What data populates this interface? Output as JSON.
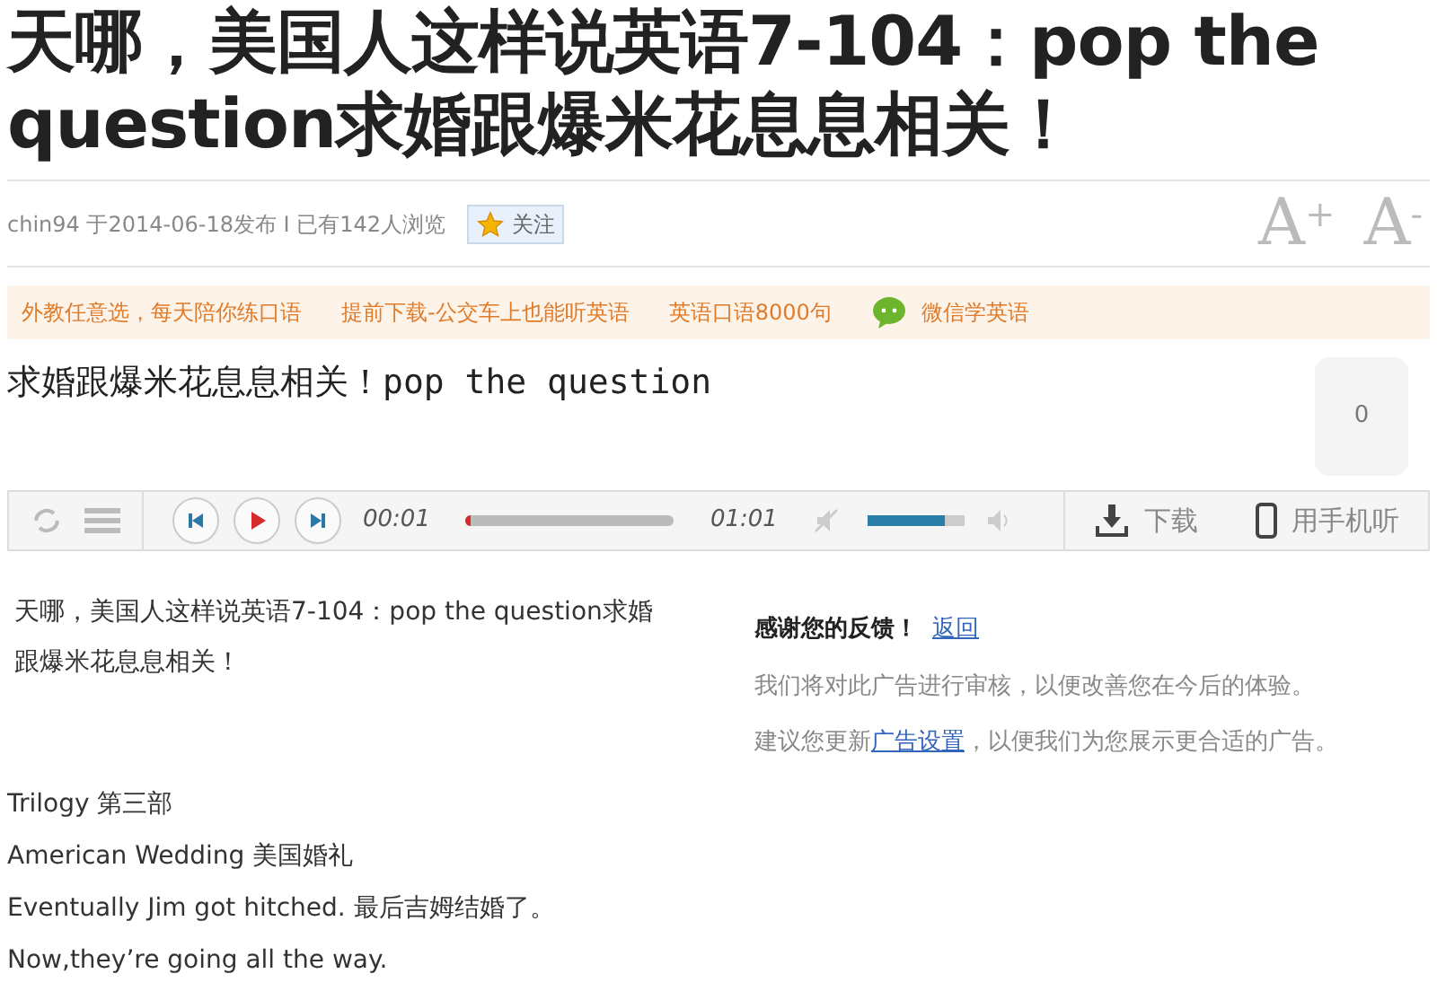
{
  "title": "天哪，美国人这样说英语7-104：pop the question求婚跟爆米花息息相关！",
  "meta": {
    "info": "chin94 于2014-06-18发布 I 已有142人浏览",
    "follow": "关注",
    "font_up": "A",
    "font_up_sup": "+",
    "font_down": "A",
    "font_down_sup": "-"
  },
  "promo_links": [
    {
      "label": "外教任意选，每天陪你练口语",
      "kind": "text"
    },
    {
      "label": "提前下载-公交车上也能听英语",
      "kind": "text"
    },
    {
      "label": "英语口语8000句",
      "kind": "text"
    },
    {
      "label": "微信学英语",
      "kind": "wechat"
    }
  ],
  "heading": "求婚跟爆米花息息相关！pop the question",
  "comment_count": "0",
  "player": {
    "elapsed": "00:01",
    "duration": "01:01",
    "progress": {
      "level": 0.02
    },
    "volume": {
      "level": 0.8
    },
    "download": "下载",
    "mobile": "用手机听"
  },
  "article": {
    "intro": "天哪，美国人这样说英语7-104：pop the question求婚跟爆米花息息相关！",
    "lines": [
      "Trilogy 第三部",
      "American Wedding 美国婚礼",
      "Eventually Jim got hitched. 最后吉姆结婚了。",
      "Now,they’re going all the way."
    ]
  },
  "feedback": {
    "thanks": "感谢您的反馈！",
    "back_link": "返回",
    "review": "我们将对此广告进行审核，以便改善您在今后的体验。",
    "suggest_before": "建议您更新",
    "settings_link": "广告设置",
    "suggest_after": "，以便我们为您展示更合适的广告。"
  }
}
